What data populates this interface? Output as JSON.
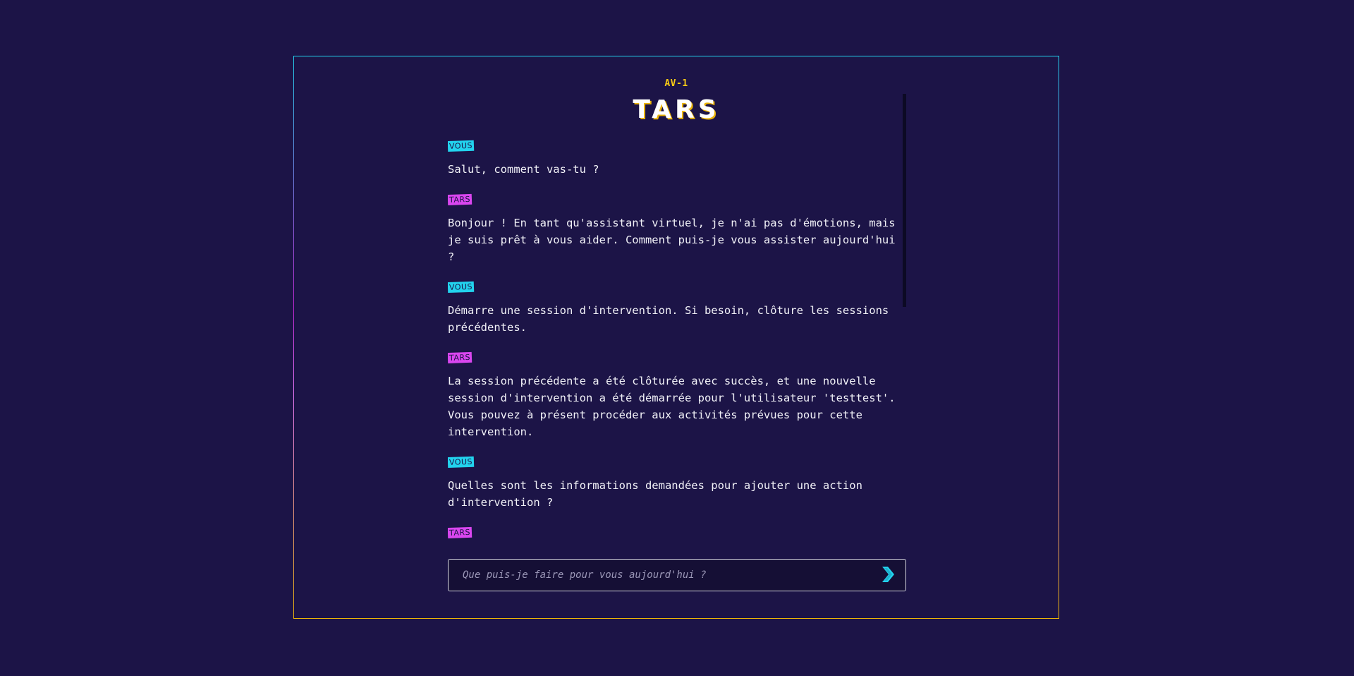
{
  "header": {
    "subtitle": "AV-1",
    "title": "TARS"
  },
  "messages": [
    {
      "role": "user",
      "author": "VOUS",
      "text": "Salut, comment vas-tu ?"
    },
    {
      "role": "bot",
      "author": "TARS",
      "text": "Bonjour ! En tant qu'assistant virtuel, je n'ai pas d'émotions, mais je suis prêt à vous aider. Comment puis-je vous assister aujourd'hui ?"
    },
    {
      "role": "user",
      "author": "VOUS",
      "text": "Démarre une session d'intervention. Si besoin, clôture les sessions précédentes."
    },
    {
      "role": "bot",
      "author": "TARS",
      "text": "La session précédente a été clôturée avec succès, et une nouvelle session d'intervention a été démarrée pour l'utilisateur 'testtest'. Vous pouvez à présent procéder aux activités prévues pour cette intervention."
    },
    {
      "role": "user",
      "author": "VOUS",
      "text": "Quelles sont les informations demandées pour ajouter une action d'intervention ?"
    },
    {
      "role": "bot",
      "author": "TARS",
      "text": ""
    }
  ],
  "input": {
    "placeholder": "Que puis-je faire pour vous aujourd'hui ?",
    "value": ""
  },
  "send_icon": "chevron-right-icon",
  "colors": {
    "background": "#1c1447",
    "user_tag": "#22d3ee",
    "bot_tag": "#d946ef",
    "accent_yellow": "#facc15",
    "send_icon": "#22d3ee"
  }
}
